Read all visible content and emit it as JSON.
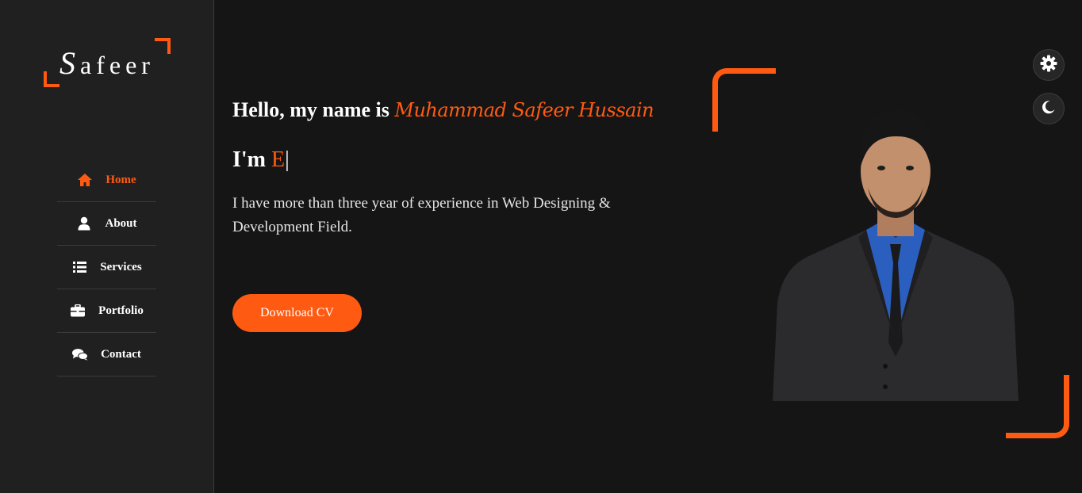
{
  "logo": {
    "first_letter": "S",
    "rest": "afeer"
  },
  "nav": {
    "items": [
      {
        "label": "Home",
        "icon": "home-icon",
        "active": true
      },
      {
        "label": "About",
        "icon": "user-icon",
        "active": false
      },
      {
        "label": "Services",
        "icon": "list-icon",
        "active": false
      },
      {
        "label": "Portfolio",
        "icon": "briefcase-icon",
        "active": false
      },
      {
        "label": "Contact",
        "icon": "chat-icon",
        "active": false
      }
    ]
  },
  "hero": {
    "greeting": "Hello, my name is ",
    "name": "Muhammad Safeer Hussain",
    "im_prefix": "I'm ",
    "typed_role": "E",
    "cursor": "|",
    "description": "I have more than three year of experience in Web Designing & Development Field.",
    "cta_label": "Download CV"
  },
  "controls": {
    "settings_icon": "gear-icon",
    "theme_icon": "moon-icon"
  },
  "colors": {
    "accent": "#ff5a12",
    "background": "#151515",
    "sidebar": "#202020"
  }
}
